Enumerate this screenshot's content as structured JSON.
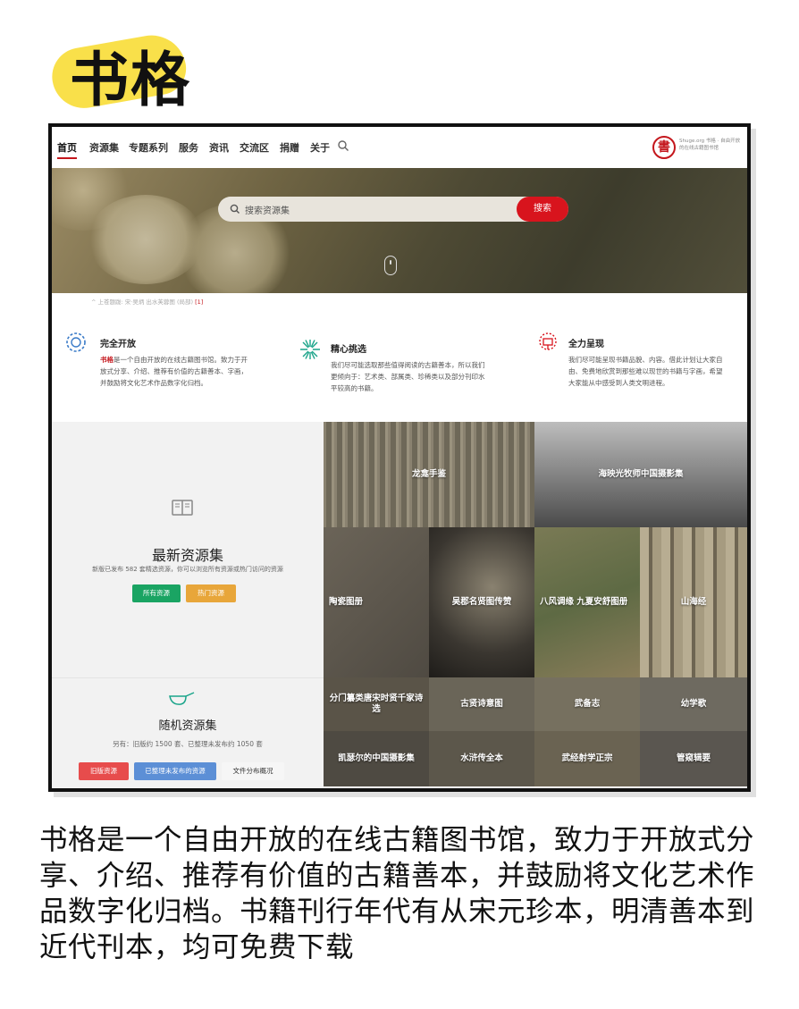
{
  "heading": {
    "title": "书格"
  },
  "nav": {
    "items": [
      "首页",
      "资源集",
      "专题系列",
      "服务",
      "资讯",
      "交流区",
      "捐赠",
      "关于"
    ],
    "logo_char": "書",
    "logo_text": "Shuge.org 书格 · 自由开放的在线古籍图书馆"
  },
  "banner": {
    "search_placeholder": "搜索资源集",
    "search_button": "搜索",
    "caption": "^ 上苍题跋: 宋·吴炳 出水芙蓉图 (局部)",
    "caption_ref": "[1]"
  },
  "features": [
    {
      "title": "完全开放",
      "brand": "书格",
      "desc": "是一个自由开放的在线古籍图书馆。致力于开放式分享、介绍、推荐有价值的古籍善本、字画，并鼓励将文化艺术作品数字化归档。"
    },
    {
      "title": "精心挑选",
      "desc": "我们尽可能选取那些值得阅读的古籍善本，所以我们更倾向于：艺术类、部属类、珍稀类以及部分刊印水平较高的书籍。"
    },
    {
      "title": "全力呈现",
      "desc": "我们尽可能呈现书籍品貌、内容。借此计划让大家自由、免费地欣赏到那些难以现世的书籍与字画，希望大家能从中感受到人类文明进程。"
    }
  ],
  "latest": {
    "title": "最新资源集",
    "desc": "新版已发布 582 套精选资源，你可以浏览所有资源或热门访问的资源",
    "btn_all": "所有资源",
    "btn_hot": "热门资源"
  },
  "random": {
    "title": "随机资源集",
    "desc": "另有：旧版约 1500 套、已整理未发布约 1050 套",
    "btn_old": "旧版资源",
    "btn_unpublished": "已整理未发布的资源",
    "btn_files": "文件分布概况"
  },
  "tiles": [
    "龙龛手鉴",
    "海映光牧师中国摄影集",
    "陶瓷图册",
    "吴郡名贤图传赞",
    "八风调缘 九夏安舒图册",
    "山海经",
    "分门纂类唐宋时贤千家诗选",
    "古贤诗意图",
    "武备志",
    "幼学歌",
    "凯瑟尔的中国摄影集",
    "水浒传全本",
    "武经射学正宗",
    "管窥辑要"
  ],
  "description": "书格是一个自由开放的在线古籍图书馆，致力于开放式分享、介绍、推荐有价值的古籍善本，并鼓励将文化艺术作品数字化归档。书籍刊行年代有从宋元珍本，明清善本到近代刊本，均可免费下载",
  "colors": {
    "accent": "#c4161c",
    "highlight": "#f9e04a",
    "green": "#1aa463",
    "yellow": "#e8a63a"
  }
}
